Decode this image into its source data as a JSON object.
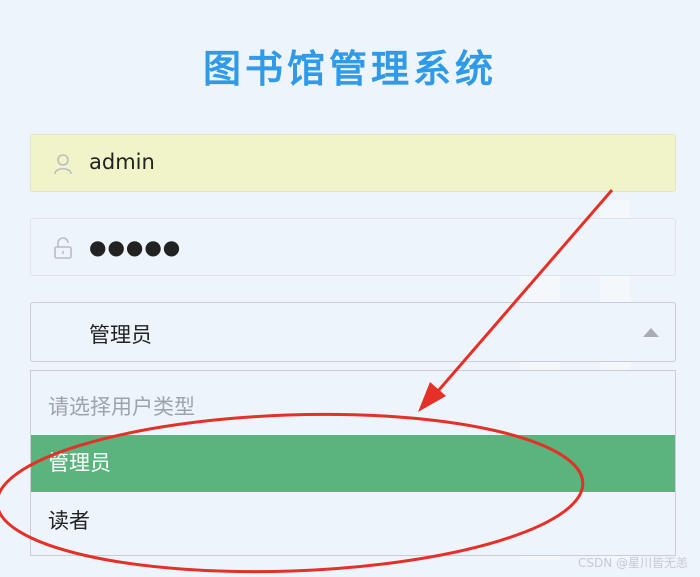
{
  "app": {
    "title": "图书馆管理系统"
  },
  "login": {
    "username": {
      "value": "admin",
      "icon": "user-icon"
    },
    "password": {
      "value": "●●●●●",
      "icon": "lock-icon"
    }
  },
  "user_type": {
    "selected": "管理员",
    "options": [
      "请选择用户类型",
      "管理员",
      "读者"
    ]
  },
  "colors": {
    "title": "#2f9be8",
    "selected_option_bg": "#5bb37e",
    "autofill_bg": "#f0f4c8",
    "annotation_red": "#e53027"
  },
  "watermark": "CSDN @星川皆无恙"
}
